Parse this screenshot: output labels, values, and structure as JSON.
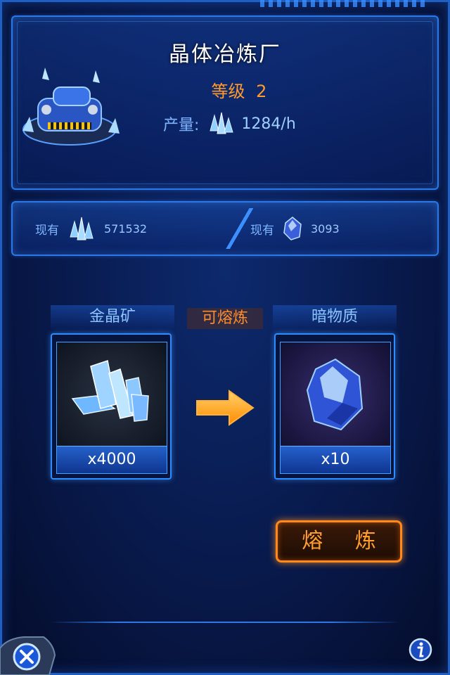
{
  "header": {
    "title": "晶体冶炼厂",
    "level_label": "等级",
    "level_value": "2",
    "production_label": "产量:",
    "production_value": "1284/h"
  },
  "resources": {
    "left_label": "现有",
    "left_value": "571532",
    "right_label": "现有",
    "right_value": "3093"
  },
  "exchange": {
    "input_title": "金晶矿",
    "status": "可熔炼",
    "output_title": "暗物质",
    "input_qty": "x4000",
    "output_qty": "x10"
  },
  "actions": {
    "smelt_label": "熔 炼"
  },
  "icons": {
    "close": "close-icon",
    "info": "info-icon"
  },
  "colors": {
    "accent_orange": "#ff9a2e",
    "frame_blue": "#2e78e6",
    "text_blue": "#7fb6ff"
  }
}
